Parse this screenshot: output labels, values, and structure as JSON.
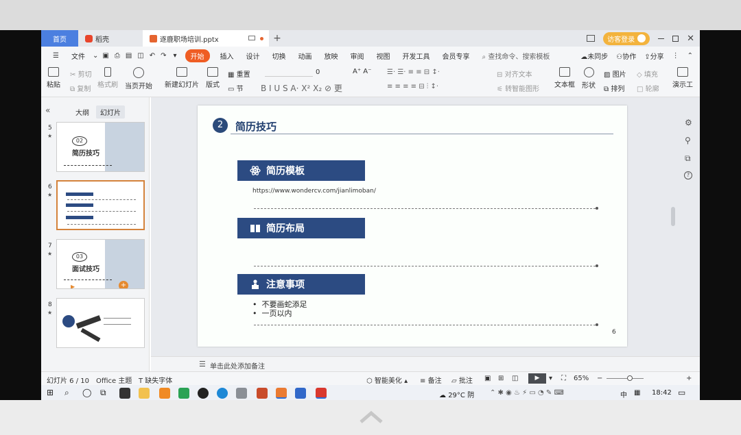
{
  "window": {
    "tabs": {
      "home": "首页",
      "daoke": "稻壳",
      "file": "逐鹿职场培训.pptx"
    },
    "visitor_login": "访客登录"
  },
  "menu": {
    "file": "文件",
    "items": [
      "开始",
      "插入",
      "设计",
      "切换",
      "动画",
      "放映",
      "审阅",
      "视图",
      "开发工具",
      "会员专享"
    ],
    "search": "查找命令、搜索模板",
    "unsync": "未同步",
    "collab": "协作",
    "share": "分享"
  },
  "toolbar": {
    "paste": "粘贴",
    "cut": "剪切",
    "copy": "复制",
    "format_painter": "格式刷",
    "play_from_current": "当页开始",
    "new_slide": "新建幻灯片",
    "layout": "版式",
    "reset": "重置",
    "section": "节",
    "font_size": "0",
    "align_text": "对齐文本",
    "smartart": "转智能图形",
    "textbox": "文本框",
    "shape": "形状",
    "picture": "图片",
    "arrange": "排列",
    "fill": "填充",
    "outline": "轮廓",
    "present": "演示工"
  },
  "sidebar": {
    "tab_outline": "大纲",
    "tab_slides": "幻灯片",
    "thumbs": [
      {
        "num": "5",
        "badge": "02",
        "title": "简历技巧"
      },
      {
        "num": "6"
      },
      {
        "num": "7",
        "badge": "03",
        "title": "面试技巧"
      },
      {
        "num": "8"
      }
    ]
  },
  "slide": {
    "number_badge": "2",
    "title": "简历技巧",
    "sections": [
      {
        "label": "简历模板",
        "icon": "atom-icon"
      },
      {
        "label": "简历布局",
        "icon": "book-icon"
      },
      {
        "label": "注意事项",
        "icon": "person-desk-icon"
      }
    ],
    "url": "https://www.wondercv.com/jianlimoban/",
    "bullets": [
      "不要画蛇添足",
      "一页以内"
    ],
    "page_number": "6"
  },
  "notes": {
    "placeholder": "单击此处添加备注"
  },
  "status": {
    "slide_pos": "幻灯片 6 / 10",
    "theme": "Office 主题",
    "missing_font": "缺失字体",
    "smart_beautify": "智能美化",
    "notes": "备注",
    "comments": "批注",
    "zoom": "65%"
  },
  "taskbar": {
    "weather": "29°C 阴",
    "input_method": "中",
    "time": "18:42"
  },
  "colors": {
    "accent": "#ef5d24",
    "section_bg": "#2c4b82",
    "home_tab": "#4b7fe0"
  }
}
